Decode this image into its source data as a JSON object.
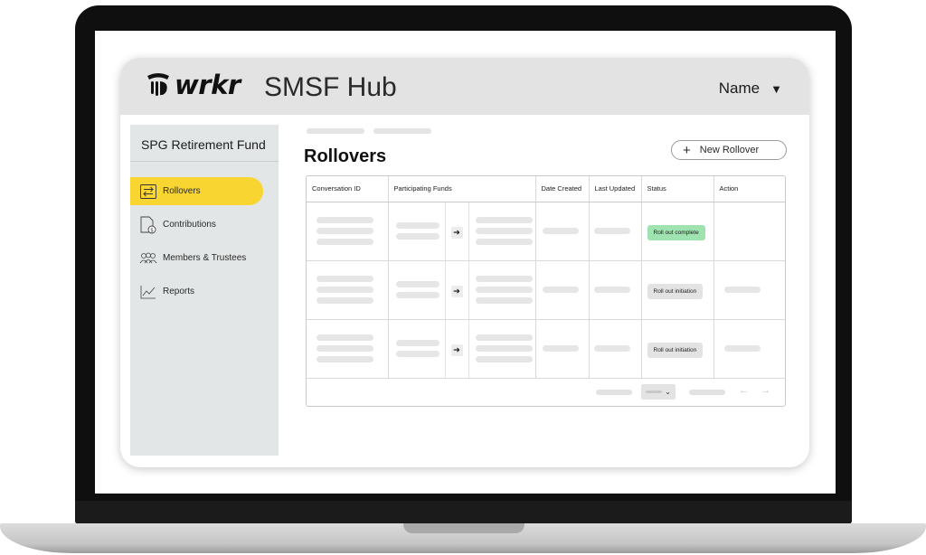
{
  "header": {
    "logo_text": "wrkr",
    "app_title": "SMSF Hub",
    "user_name": "Name",
    "user_caret": "▼"
  },
  "sidebar": {
    "fund_name": "SPG Retirement Fund",
    "items": [
      {
        "label": "Rollovers",
        "icon": "transfer-arrows-icon",
        "active": true
      },
      {
        "label": "Contributions",
        "icon": "document-dollar-icon",
        "active": false
      },
      {
        "label": "Members & Trustees",
        "icon": "people-icon",
        "active": false
      },
      {
        "label": "Reports",
        "icon": "line-chart-icon",
        "active": false
      }
    ]
  },
  "main": {
    "title": "Rollovers",
    "new_button_icon": "+",
    "new_button_label": "New Rollover",
    "table": {
      "columns": [
        "Conversation ID",
        "Participating Funds",
        "Date Created",
        "Last Updated",
        "Status",
        "Action"
      ],
      "rows": [
        {
          "status": "Roll out complete",
          "status_type": "complete",
          "arrow": "➔"
        },
        {
          "status": "Roll out initiation",
          "status_type": "initiation",
          "arrow": "➔"
        },
        {
          "status": "Roll out initiation",
          "status_type": "initiation",
          "arrow": "➔"
        }
      ]
    },
    "pagination": {
      "page_size_caret": "⌄",
      "prev_next": "← →"
    }
  },
  "colors": {
    "accent_yellow": "#f8d530",
    "status_complete": "#9fe3b1",
    "status_neutral": "#e3e3e3",
    "header_gray": "#e3e3e3",
    "sidebar_gray": "#e3e6e6"
  }
}
